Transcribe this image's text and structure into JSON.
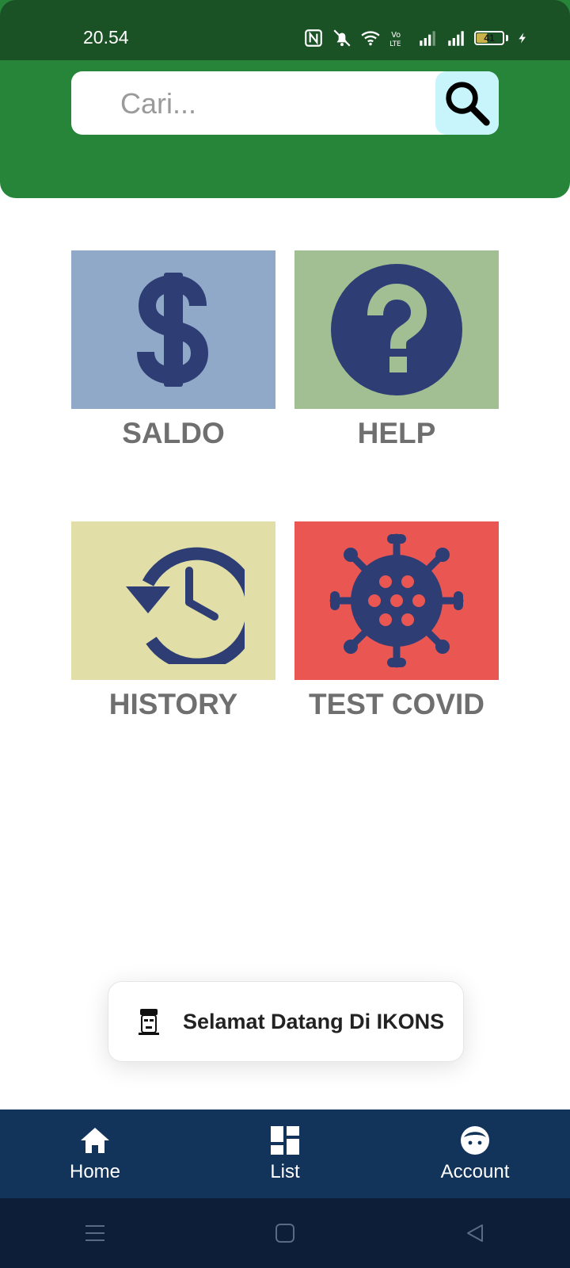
{
  "status_bar": {
    "time": "20.54",
    "battery_level": "41",
    "icons": [
      "nfc-icon",
      "silent-bell-icon",
      "wifi-icon",
      "volte-icon",
      "signal-icon",
      "signal-icon",
      "battery-icon",
      "charging-icon"
    ]
  },
  "search": {
    "placeholder": "Cari...",
    "value": "",
    "button_icon": "search-icon"
  },
  "menu": {
    "tiles": [
      {
        "label": "SALDO",
        "icon": "dollar-icon",
        "color": "#91a9c8"
      },
      {
        "label": "HELP",
        "icon": "help-icon",
        "color": "#a2bf94"
      },
      {
        "label": "HISTORY",
        "icon": "history-icon",
        "color": "#e1dfa7"
      },
      {
        "label": "TEST COVID",
        "icon": "virus-icon",
        "color": "#ea5753"
      }
    ]
  },
  "toast": {
    "text": "Selamat Datang Di IKONS",
    "icon": "app-logo-icon"
  },
  "bottom_nav": {
    "items": [
      {
        "label": "Home",
        "icon": "home-icon"
      },
      {
        "label": "List",
        "icon": "dashboard-icon"
      },
      {
        "label": "Account",
        "icon": "face-icon"
      }
    ]
  },
  "system_nav": [
    "menu-icon",
    "home-square-icon",
    "back-icon"
  ],
  "colors": {
    "header": "#27853a",
    "status_bar": "#1a5226",
    "icon_dark": "#2e3e75",
    "label_gray": "#6f6f6f",
    "bottom_nav": "#12335a",
    "system_nav": "#0d1e38",
    "search_button": "#c8f5fb"
  }
}
